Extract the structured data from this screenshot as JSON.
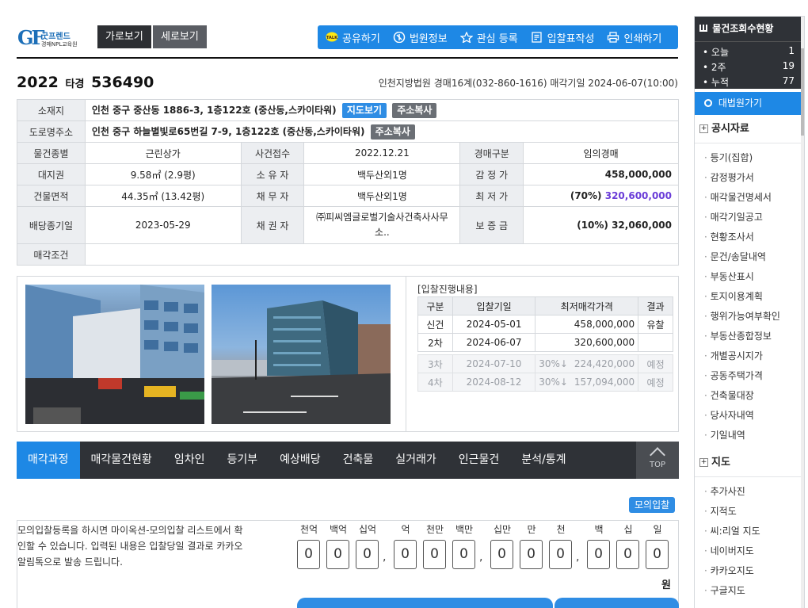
{
  "brand": {
    "mark": "GF",
    "name": "굿프렌드",
    "sub": "경매NPL교육원"
  },
  "view_buttons": [
    "가로보기",
    "세로보기"
  ],
  "toolbar": [
    {
      "icon": "kakao-talk-icon",
      "label": "공유하기"
    },
    {
      "icon": "court-icon",
      "label": "법원정보"
    },
    {
      "icon": "star-icon",
      "label": "관심 등록"
    },
    {
      "icon": "document-icon",
      "label": "입찰표작성"
    },
    {
      "icon": "printer-icon",
      "label": "인쇄하기"
    }
  ],
  "case": {
    "year": "2022",
    "type": "타경",
    "number": "536490"
  },
  "court_info": "인천지방법원 경매16계(032-860-1616) 매각기일 2024-06-07(10:00)",
  "info": {
    "address_label": "소재지",
    "address": "인천 중구 중산동 1886-3, 1층122호 (중산동,스카이타워)",
    "map_btn": "지도보기",
    "copy_btn": "주소복사",
    "road_label": "도로명주소",
    "road": "인천 중구 하늘별빛로65번길 7-9, 1층122호 (중산동,스카이타워)",
    "row1": [
      "물건종별",
      "근린상가",
      "사건접수",
      "2022.12.21",
      "경매구분",
      "임의경매"
    ],
    "row2": [
      "대지권",
      "9.58㎡ (2.9평)",
      "소 유 자",
      "백두산외1명",
      "감 정 가",
      "458,000,000"
    ],
    "row3": [
      "건물면적",
      "44.35㎡ (13.42평)",
      "채 무 자",
      "백두산외1명",
      "최 저 가",
      "(70%)",
      "320,600,000"
    ],
    "row4": [
      "배당종기일",
      "2023-05-29",
      "채 권 자",
      "㈜피씨엠글로벌기술사건축사사무소..",
      "보 증 금",
      "(10%) 32,060,000"
    ],
    "row5_label": "매각조건"
  },
  "bidding": {
    "title": "[입찰진행내용]",
    "headers": [
      "구분",
      "입찰기일",
      "최저매각가격",
      "결과"
    ],
    "rows": [
      [
        "신건",
        "2024-05-01",
        "458,000,000",
        "유찰"
      ],
      [
        "2차",
        "2024-06-07",
        "320,600,000",
        ""
      ]
    ],
    "future": [
      [
        "3차",
        "2024-07-10",
        "30%↓",
        "224,420,000",
        "예정"
      ],
      [
        "4차",
        "2024-08-12",
        "30%↓",
        "157,094,000",
        "예정"
      ]
    ]
  },
  "tabs": [
    "매각과정",
    "매각물건현황",
    "임차인",
    "등기부",
    "예상배당",
    "건축물",
    "실거래가",
    "인근물건",
    "분석/통계"
  ],
  "top_label": "TOP",
  "mock": {
    "button": "모의입찰",
    "text": "모의입찰등록을 하시면 마이옥션-모의입찰 리스트에서 확인할 수 있습니다. 입력된 내용은 입찰당일 결과로 카카오알림톡으로 발송 드립니다.",
    "units": [
      "천억",
      "백억",
      "십억",
      "억",
      "천만",
      "백만",
      "십만",
      "만",
      "천",
      "백",
      "십",
      "일"
    ],
    "digits": [
      "0",
      "0",
      "0",
      "0",
      "0",
      "0",
      "0",
      "0",
      "0",
      "0",
      "0",
      "0"
    ],
    "won": "원"
  },
  "sidebar": {
    "title": "물건조회수현황",
    "stats": [
      [
        "오늘",
        "1"
      ],
      [
        "2주",
        "19"
      ],
      [
        "누적",
        "77"
      ]
    ],
    "court_link": "대법원가기",
    "sections": [
      {
        "title": "공시자료",
        "items": [
          "등기(집합)",
          "감정평가서",
          "매각물건명세서",
          "매각기일공고",
          "현황조사서",
          "문건/송달내역",
          "부동산표시",
          "토지이용계획",
          "행위가능여부확인",
          "부동산종합정보",
          "개별공시지가",
          "공동주택가격",
          "건축물대장",
          "당사자내역",
          "기일내역"
        ]
      },
      {
        "title": "지도",
        "items": [
          "추가사진",
          "지적도",
          "씨:리얼 지도",
          "네이버지도",
          "카카오지도",
          "구글지도"
        ]
      }
    ]
  }
}
